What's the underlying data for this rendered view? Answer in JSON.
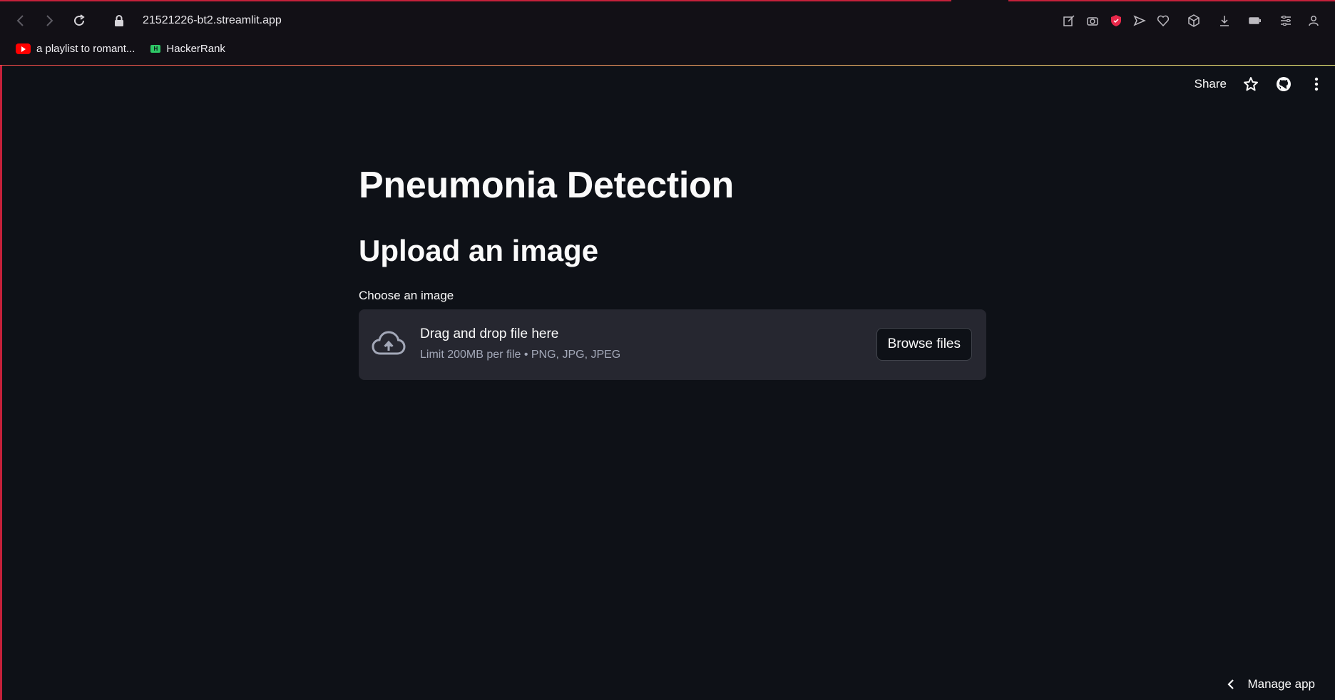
{
  "browser": {
    "url": "21521226-bt2.streamlit.app",
    "bookmarks": [
      {
        "label": "a playlist to romant...",
        "icon": "youtube-icon"
      },
      {
        "label": "HackerRank",
        "icon": "hackerrank-icon"
      }
    ],
    "hackerrank_logo_text": "H",
    "toolbar_icons": [
      "edit-icon",
      "camera-icon",
      "shield-icon",
      "send-icon",
      "heart-icon",
      "cube-icon",
      "download-icon",
      "battery-icon",
      "sliders-icon",
      "user-icon"
    ]
  },
  "header": {
    "share_label": "Share"
  },
  "main": {
    "title": "Pneumonia Detection",
    "subtitle": "Upload an image",
    "uploader": {
      "label": "Choose an image",
      "drop_text": "Drag and drop file here",
      "limit_text": "Limit 200MB per file • PNG, JPG, JPEG",
      "browse_label": "Browse files"
    }
  },
  "footer": {
    "manage_label": "Manage app"
  },
  "colors": {
    "background": "#0e1117",
    "dropzone": "#262730",
    "accent_gradient_start": "#ff4b4b",
    "accent_gradient_end": "#fffd80"
  }
}
